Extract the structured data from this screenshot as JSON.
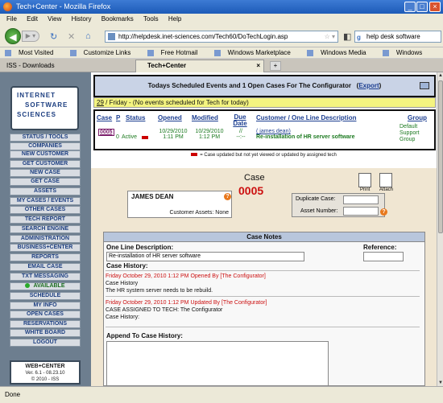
{
  "window": {
    "title": "Tech+Center - Mozilla Firefox"
  },
  "menu": [
    "File",
    "Edit",
    "View",
    "History",
    "Bookmarks",
    "Tools",
    "Help"
  ],
  "url": "http://helpdesk.inet-sciences.com/Tech60/DoTechLogin.asp",
  "search_value": "help desk software",
  "bookmarks": [
    "Most Visited",
    "Customize Links",
    "Free Hotmail",
    "Windows Marketplace",
    "Windows Media",
    "Windows"
  ],
  "tabs": [
    {
      "label": "ISS - Downloads"
    },
    {
      "label": "Tech+Center"
    }
  ],
  "logo": {
    "line1": "INTERNET",
    "line2": "SOFTWARE",
    "line3": "SCIENCES"
  },
  "nav": [
    "STATUS / TOOLS",
    "COMPANIES",
    "NEW CUSTOMER",
    "GET CUSTOMER",
    "NEW CASE",
    "GET CASE",
    "ASSETS",
    "MY CASES / EVENTS",
    "OTHER CASES",
    "TECH REPORT",
    "SEARCH ENGINE",
    "ADMINISTRATION",
    "BUSINESS+CENTER",
    "REPORTS",
    "EMAIL CASE",
    "TXT MESSAGING",
    "AVAILABLE",
    "SCHEDULE",
    "MY INFO",
    "OPEN CASES",
    "RESERVATIONS",
    "WHITE BOARD",
    "LOGOUT"
  ],
  "version": {
    "product": "WEB+CENTER",
    "ver": "Ver. 6.1 - 08.23.10",
    "copy": "© 2010 - ISS"
  },
  "schedule": {
    "title": "Todays Scheduled Events and 1  Open Cases For  The Configurator",
    "export_label": "Export"
  },
  "today": {
    "date": "29",
    "text": " / Friday - (No events scheduled for Tech for today)"
  },
  "case_table": {
    "headers": [
      "Case",
      "P",
      "Status",
      "Opened",
      "Modified",
      "Due Date",
      "Customer / One Line Description",
      "Group"
    ],
    "row": {
      "case": "0005",
      "priority": "0",
      "status": "Active",
      "opened_date": "10/29/2010",
      "opened_time": "1:11 PM",
      "modified_date": "10/29/2010",
      "modified_time": "1:12 PM",
      "due_date": "//",
      "due_time": "--:--",
      "customer": "( james dean)",
      "description": "Re-installation of HR server software",
      "group_line1": "Default",
      "group_line2": "Support",
      "group_line3": "Group"
    }
  },
  "legend": "= Case updated but not yet viewed or updated by assigned tech",
  "case": {
    "title": "Case",
    "number": "0005",
    "customer_name": "JAMES DEAN",
    "customer_assets": "Customer Assets:  None",
    "print_label": "Print",
    "attach_label": "Attach",
    "duplicate_label": "Duplicate Case:",
    "asset_label": "Asset Number:"
  },
  "notes": {
    "header": "Case Notes",
    "desc_label": "One Line Description:",
    "ref_label": "Reference:",
    "desc_value": "Re-installation of HR server software",
    "history_label": "Case History:",
    "entry1_head": "Friday October 29, 2010 1:12 PM Opened By [The Configurator]",
    "entry1_l1": "Case History",
    "entry1_l2": "The HR system server needs to be rebuild.",
    "entry2_head": "Friday October 29, 2010 1:12 PM Updated By [The Configurator]",
    "entry2_l1": "CASE ASSIGNED TO TECH: The Configurator",
    "entry2_l2": "Case History:",
    "append_label": "Append To Case History:"
  },
  "status": "Done"
}
